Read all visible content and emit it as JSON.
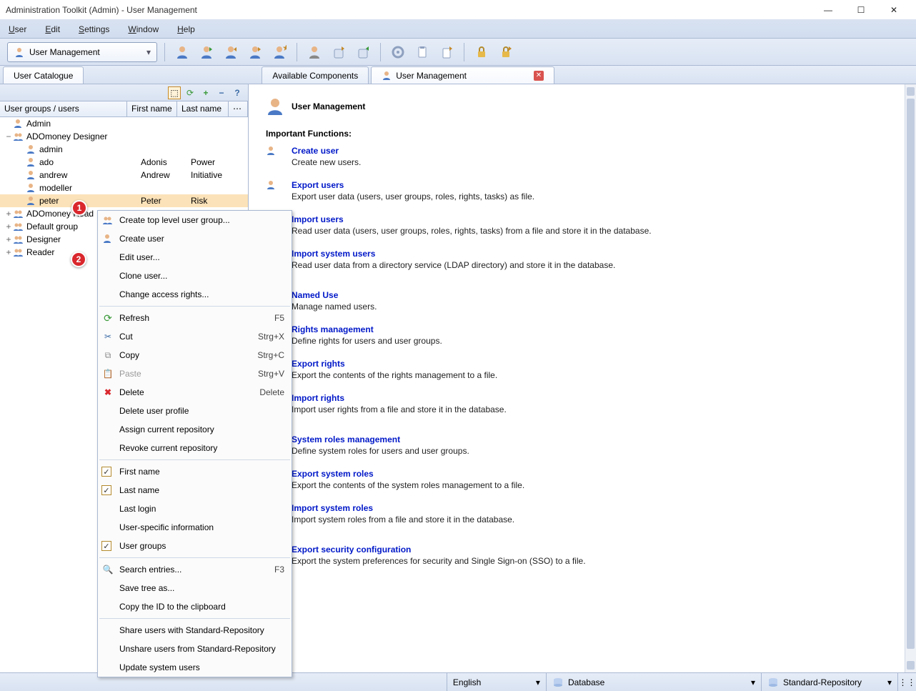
{
  "window": {
    "title": "Administration Toolkit (Admin) - User Management"
  },
  "menu": [
    "User",
    "Edit",
    "Settings",
    "Window",
    "Help"
  ],
  "toolbar_dropdown": {
    "label": "User Management"
  },
  "tabs": {
    "left": "User Catalogue",
    "centerA": "Available Components",
    "centerB": "User Management"
  },
  "catalog": {
    "cols": {
      "a": "User groups / users",
      "b": "First name",
      "c": "Last name"
    },
    "rows": [
      {
        "ind": 0,
        "exp": "",
        "type": "user",
        "n": "Admin",
        "f": "",
        "l": ""
      },
      {
        "ind": 0,
        "exp": "−",
        "type": "group",
        "n": "ADOmoney Designer",
        "f": "",
        "l": ""
      },
      {
        "ind": 1,
        "exp": "",
        "type": "user",
        "n": "admin",
        "f": "",
        "l": ""
      },
      {
        "ind": 1,
        "exp": "",
        "type": "user",
        "n": "ado",
        "f": "Adonis",
        "l": "Power"
      },
      {
        "ind": 1,
        "exp": "",
        "type": "user",
        "n": "andrew",
        "f": "Andrew",
        "l": "Initiative"
      },
      {
        "ind": 1,
        "exp": "",
        "type": "user",
        "n": "modeller",
        "f": "",
        "l": ""
      },
      {
        "ind": 1,
        "exp": "",
        "type": "user",
        "n": "peter",
        "f": "Peter",
        "l": "Risk",
        "sel": true
      },
      {
        "ind": 0,
        "exp": "+",
        "type": "group",
        "n": "ADOmoney Read",
        "f": "",
        "l": ""
      },
      {
        "ind": 0,
        "exp": "+",
        "type": "group",
        "n": "Default group",
        "f": "",
        "l": ""
      },
      {
        "ind": 0,
        "exp": "+",
        "type": "group",
        "n": "Designer",
        "f": "",
        "l": ""
      },
      {
        "ind": 0,
        "exp": "+",
        "type": "group",
        "n": "Reader",
        "f": "",
        "l": ""
      }
    ]
  },
  "page": {
    "title": "User Management",
    "subtitle": "Important Functions:",
    "funcs": [
      {
        "t": "Create user",
        "d": "Create new users."
      },
      {
        "t": "Export users",
        "d": "Export user data (users, user groups, roles, rights, tasks) as file."
      },
      {
        "t": "Import users",
        "d": "Read user data (users, user groups, roles, rights, tasks) from a file and store it in the database."
      },
      {
        "t": "Import system users",
        "d": "Read user data from a directory service (LDAP directory) and store it in the database."
      },
      {
        "t": "Named Use",
        "d": "Manage named users."
      },
      {
        "t": "Rights management",
        "d": "Define rights for users and user groups."
      },
      {
        "t": "Export rights",
        "d": "Export the contents of the rights management to a file."
      },
      {
        "t": "Import rights",
        "d": "Import user rights from a file and store it in the database."
      },
      {
        "t": "System roles management",
        "d": "Define system roles for users and user groups."
      },
      {
        "t": "Export system roles",
        "d": "Export the contents of the system roles management to a file."
      },
      {
        "t": "Import system roles",
        "d": "Import system roles from a file and store it in the database."
      },
      {
        "t": "Export security configuration",
        "d": "Export the system preferences for security and Single Sign-on (SSO) to a file."
      }
    ]
  },
  "ctx": [
    {
      "l": "Create top level user group...",
      "i": "group"
    },
    {
      "l": "Create user",
      "i": "user"
    },
    {
      "l": "Edit user..."
    },
    {
      "l": "Clone user..."
    },
    {
      "l": "Change access rights..."
    },
    {
      "sep": true
    },
    {
      "l": "Refresh",
      "i": "refresh",
      "sc": "F5"
    },
    {
      "l": "Cut",
      "i": "cut",
      "sc": "Strg+X"
    },
    {
      "l": "Copy",
      "i": "copy",
      "sc": "Strg+C"
    },
    {
      "l": "Paste",
      "i": "paste",
      "sc": "Strg+V",
      "dis": true
    },
    {
      "l": "Delete",
      "i": "delete",
      "sc": "Delete"
    },
    {
      "l": "Delete user profile"
    },
    {
      "l": "Assign current repository"
    },
    {
      "l": "Revoke current repository"
    },
    {
      "sep": true
    },
    {
      "l": "First name",
      "chk": true
    },
    {
      "l": "Last name",
      "chk": true
    },
    {
      "l": "Last login"
    },
    {
      "l": "User-specific information"
    },
    {
      "l": "User groups",
      "chk": true
    },
    {
      "sep": true
    },
    {
      "l": "Search entries...",
      "i": "search",
      "sc": "F3"
    },
    {
      "l": "Save tree as..."
    },
    {
      "l": "Copy the ID to the clipboard"
    },
    {
      "sep": true
    },
    {
      "l": "Share users with Standard-Repository"
    },
    {
      "l": "Unshare users from Standard-Repository"
    },
    {
      "l": "Update system users"
    }
  ],
  "status": {
    "lang": "English",
    "db": "Database",
    "repo": "Standard-Repository"
  },
  "badges": {
    "b1": "1",
    "b2": "2"
  }
}
